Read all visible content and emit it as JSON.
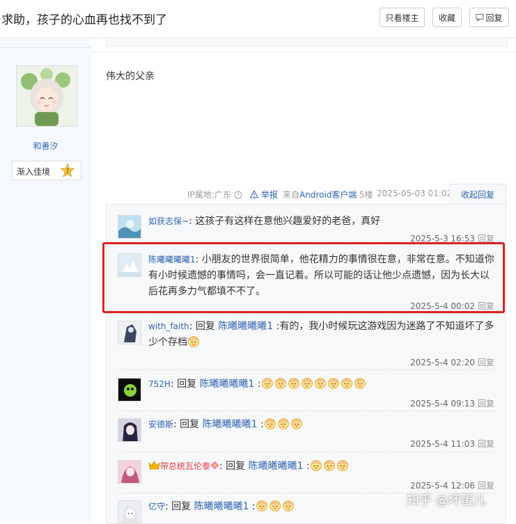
{
  "header": {
    "title": "求助，孩子的心血再也找不到了",
    "buttons": {
      "only_op": "只看楼主",
      "favorite": "收藏",
      "reply": "回复"
    }
  },
  "post": {
    "author": "和善汐",
    "badge_label": "渐入佳境",
    "badge_level": "7",
    "content": "伟大的父亲",
    "meta": {
      "ip": "IP属地:广东",
      "report": "举报",
      "source_prefix": "来自",
      "source_client": "Android客户端",
      "floor": "5楼",
      "datetime": "2025-05-03 01:02",
      "collapse": "收起回复"
    }
  },
  "replies": [
    {
      "name": "如获志保~",
      "sep": ":",
      "text": " 这孩子有这样在意他兴趣爱好的老爸，真好",
      "time": "2025-5-3 16:53",
      "action": "回复"
    },
    {
      "name": "陈曦曦曦曦1",
      "sep": ":",
      "text": " 小朋友的世界很简单，他花精力的事情很在意，非常在意。不知道你有小时候遗憾的事情吗，会一直记着。所以可能的话让他少点遗憾，因为长大以后花再多力气都填不不了。",
      "time": "2025-5-4 00:02",
      "action": "回复"
    },
    {
      "name": "with_faith",
      "sep": ":",
      "reply_word": " 回复 ",
      "target": "陈曦曦曦曦1",
      "text": " :有的，我小时候玩这游戏因为迷路了不知道坏了多少个存档",
      "emoji_count": 1,
      "time": "2025-5-4 02:20",
      "action": "回复"
    },
    {
      "name": "752H",
      "sep": ":",
      "reply_word": " 回复 ",
      "target": "陈曦曦曦曦1",
      "text": " :",
      "emoji_count": 8,
      "time": "2025-5-4 09:13",
      "action": "回复"
    },
    {
      "name": "安德斯",
      "sep": ":",
      "reply_word": " 回复 ",
      "target": "陈曦曦曦曦1",
      "text": " :",
      "emoji_count": 3,
      "time": "2025-5-4 11:03",
      "action": "回复"
    },
    {
      "name": "带总统瓦伦泰",
      "sep": ":",
      "reply_word": " 回复 ",
      "target": "陈曦曦曦曦1",
      "text": " :",
      "emoji_count": 3,
      "time": "2025-5-4 12:06",
      "action": "回复"
    },
    {
      "name": "亿守",
      "sep": ":",
      "reply_word": " 回复 ",
      "target": "陈曦曦曦曦1",
      "text": " :",
      "emoji_count": 3,
      "time": "",
      "action": ""
    }
  ],
  "watermark": "知乎 @坏蛋儿",
  "colors": {
    "link": "#2d64b3",
    "highlight_border": "#e02020",
    "reply_bg": "#f7f8fa"
  },
  "icons": [
    "comment-icon",
    "help-circle-icon",
    "warning-triangle-icon",
    "level-star-icon",
    "emoji-face-icon",
    "crown-icon",
    "flower-icon"
  ]
}
